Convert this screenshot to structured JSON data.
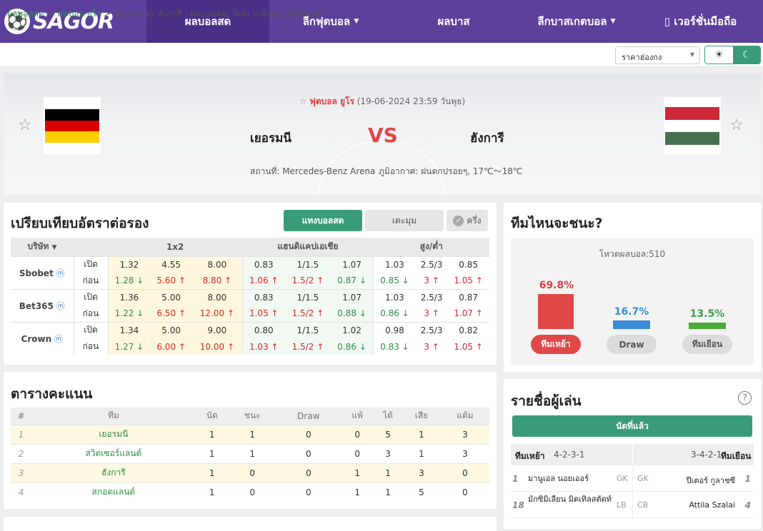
{
  "nav": {
    "logo": "SAGOR",
    "items": [
      "ผลบอลสด",
      "ลีกฟุตบอล",
      "ผลบาส",
      "ลีกบาสเกตบอล",
      "เวอร์ชั่นมือถือ"
    ]
  },
  "breadcrumb": {
    "home": "ผลบอลสด",
    "league": "ฟุตบอล ยูโร",
    "title": "เยอรมนี vs  ฮังการี ,  ผลบอลสด,  วิเคราะห์บอล,  ทีเด็ดบอล"
  },
  "odds_select": "ราคาฮ่องกง",
  "match": {
    "league": "ฟุตบอล ยูโร",
    "datetime": "(19-06-2024 23:59 วันพุธ)",
    "home": "เยอรมนี",
    "away": "ฮังการี",
    "vs": "VS",
    "venue": "สถานที่: Mercedes-Benz Arena",
    "weather": "ภูมิอากาศ: ฝนตกปรอยๆ, 17℃～18℃",
    "home_flag_colors": [
      "#000000",
      "#dd0000",
      "#ffce00"
    ],
    "away_flag_colors": [
      "#ce2939",
      "#ffffff",
      "#477050"
    ]
  },
  "odds": {
    "title": "เปรียบเทียบอัตราต่อรอง",
    "btn_live": "แทงบอลสด",
    "btn_early": "เดะมุม",
    "btn_half": "ครึ่ง",
    "col_company": "บริษัท",
    "col_1x2": "1x2",
    "col_ah": "แฮนดิแคปเอเชีย",
    "col_ou": "สูง/ต่ำ",
    "label_open": "เปิด",
    "label_before": "ก่อน",
    "rows": [
      {
        "book": "Sbobet",
        "open": [
          "1.32",
          "4.55",
          "8.00",
          "0.83",
          "1/1.5",
          "1.07",
          "1.03",
          "2.5/3",
          "0.85"
        ],
        "before": [
          "1.28",
          "5.60",
          "8.80",
          "1.06",
          "1.5/2",
          "0.87",
          "0.85",
          "3",
          "1.05"
        ],
        "dir": [
          "d",
          "u",
          "u",
          "u",
          "u",
          "d",
          "d",
          "u",
          "u"
        ]
      },
      {
        "book": "Bet365",
        "open": [
          "1.36",
          "5.00",
          "8.00",
          "0.83",
          "1/1.5",
          "1.07",
          "1.03",
          "2.5/3",
          "0.87"
        ],
        "before": [
          "1.22",
          "6.50",
          "12.00",
          "1.05",
          "1.5/2",
          "0.88",
          "0.86",
          "3",
          "1.07"
        ],
        "dir": [
          "d",
          "u",
          "u",
          "u",
          "u",
          "d",
          "d",
          "u",
          "u"
        ]
      },
      {
        "book": "Crown",
        "open": [
          "1.34",
          "5.00",
          "9.00",
          "0.80",
          "1/1.5",
          "1.02",
          "0.98",
          "2.5/3",
          "0.82"
        ],
        "before": [
          "1.27",
          "6.00",
          "10.00",
          "1.03",
          "1.5/2",
          "0.86",
          "0.83",
          "3",
          "1.05"
        ],
        "dir": [
          "d",
          "u",
          "u",
          "u",
          "u",
          "d",
          "d",
          "u",
          "u"
        ]
      }
    ]
  },
  "predict": {
    "title": "ทีมไหนจะชนะ?",
    "votes": "โหวตผลบอล:510",
    "home_pct": 69.8,
    "draw_pct": 16.7,
    "away_pct": 13.5,
    "home_pct_label": "69.8%",
    "draw_pct_label": "16.7%",
    "away_pct_label": "13.5%",
    "home_btn": "ทีมเหย้า",
    "draw_btn": "Draw",
    "away_btn": "ทีมเยือน"
  },
  "standings": {
    "title": "ตารางคะแนน",
    "headers": [
      "#",
      "ทีม",
      "นัด",
      "ชนะ",
      "Draw",
      "แพ้",
      "ได้",
      "เสีย",
      "แต้ม"
    ],
    "rows": [
      [
        "1",
        "เยอรมนี",
        "1",
        "1",
        "0",
        "0",
        "5",
        "1",
        "3"
      ],
      [
        "2",
        "สวิตเซอร์แลนด์",
        "1",
        "1",
        "0",
        "0",
        "3",
        "1",
        "3"
      ],
      [
        "3",
        "ฮังการี",
        "1",
        "0",
        "0",
        "1",
        "1",
        "3",
        "0"
      ],
      [
        "4",
        "สกอตแลนด์",
        "1",
        "0",
        "0",
        "1",
        "1",
        "5",
        "0"
      ]
    ]
  },
  "lineup": {
    "title": "รายชื่อผู้เล่น",
    "btn": "นัดที่แล้ว",
    "home_label": "ทีมเหย้า",
    "home_form": "4-2-3-1",
    "away_label": "ทีมเยือน",
    "away_form": "3-4-2-1",
    "rows": [
      {
        "hn": "1",
        "hname": "มานูเอล นอยเออร์",
        "hpos": "GK",
        "apos": "GK",
        "aname": "ปีเตอร์ กูลาชซี",
        "an": "1"
      },
      {
        "hn": "18",
        "hname": "มักซิมิเลียน มิตเทิลสตัดท์",
        "hpos": "LB",
        "apos": "CB",
        "aname": "Attila Szalai",
        "an": "4"
      }
    ]
  }
}
